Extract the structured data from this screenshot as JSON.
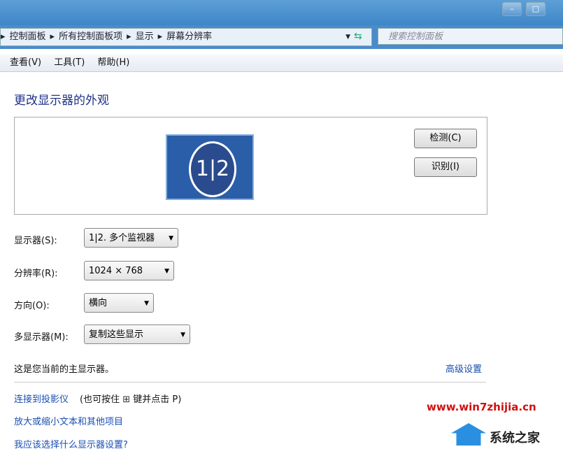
{
  "window": {
    "minimize": "–",
    "maximize": "□"
  },
  "address": {
    "crumbs": [
      "控制面板",
      "所有控制面板项",
      "显示",
      "屏幕分辨率"
    ],
    "search_placeholder": "搜索控制面板"
  },
  "menu": [
    "查看(V)",
    "工具(T)",
    "帮助(H)"
  ],
  "main": {
    "title": "更改显示器的外观",
    "monitor_label": "1|2",
    "detect": "检测(C)",
    "identify": "识别(I)",
    "fields": [
      {
        "label": "显示器(S):",
        "value": "1|2. 多个监视器"
      },
      {
        "label": "分辨率(R):",
        "value": "1024 × 768"
      },
      {
        "label": "方向(O):",
        "value": "横向"
      },
      {
        "label": "多显示器(M):",
        "value": "复制这些显示"
      }
    ],
    "primary_note": "这是您当前的主显示器。",
    "advanced": "高级设置",
    "links": {
      "projector": "连接到投影仪",
      "projector_hint": "(也可按住",
      "projector_hint2": "键并点击 P)",
      "text_size": "放大或缩小文本和其他项目",
      "which": "我应该选择什么显示器设置?"
    }
  },
  "watermark": {
    "url": "www.win7zhijia.cn",
    "brand": "系统之家"
  }
}
